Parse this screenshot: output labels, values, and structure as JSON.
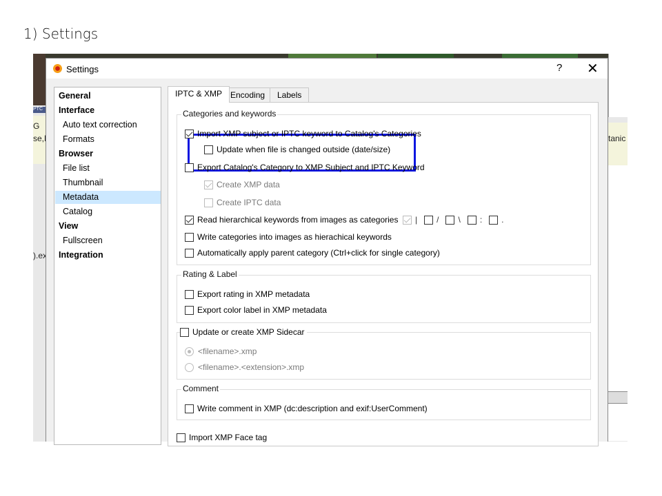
{
  "slide_title": "1) Settings",
  "background_app": {
    "left_texts": [
      "G",
      "se,E",
      ").ex",
      "PTC"
    ],
    "right_text": "tanic"
  },
  "dialog": {
    "title": "Settings",
    "help_label": "?",
    "close_label": "✕"
  },
  "tree": [
    {
      "label": "General",
      "level": 0
    },
    {
      "label": "Interface",
      "level": 0
    },
    {
      "label": "Auto text correction",
      "level": 1
    },
    {
      "label": "Formats",
      "level": 1
    },
    {
      "label": "Browser",
      "level": 0
    },
    {
      "label": "File list",
      "level": 1
    },
    {
      "label": "Thumbnail",
      "level": 1
    },
    {
      "label": "Metadata",
      "level": 1,
      "selected": true
    },
    {
      "label": "Catalog",
      "level": 1
    },
    {
      "label": "View",
      "level": 0
    },
    {
      "label": "Fullscreen",
      "level": 1
    },
    {
      "label": "Integration",
      "level": 0
    }
  ],
  "tabs": [
    "IPTC & XMP",
    "Encoding",
    "Labels"
  ],
  "groups": {
    "categories": {
      "title": "Categories and keywords",
      "import_xmp": {
        "label": "Import XMP subject or IPTC keyword to Catalog's Categories",
        "checked": true
      },
      "update_outside": {
        "label": "Update when file is changed outside (date/size)",
        "checked": false
      },
      "export_catalog": {
        "label": "Export Catalog's Category to XMP Subject and IPTC Keyword",
        "checked": false
      },
      "create_xmp": {
        "label": "Create XMP data",
        "checked": true,
        "disabled": true
      },
      "create_iptc": {
        "label": "Create IPTC data",
        "checked": false,
        "disabled": true
      },
      "read_hier": {
        "label": "Read hierarchical keywords from images as categories",
        "checked": true
      },
      "separators": [
        "|",
        "/",
        "\\",
        ":",
        "."
      ],
      "write_cat": {
        "label": "Write categories into images as hierachical keywords",
        "checked": false
      },
      "auto_parent": {
        "label": "Automatically apply parent category (Ctrl+click for single category)",
        "checked": false
      }
    },
    "rating": {
      "title": "Rating & Label",
      "export_rating": {
        "label": "Export rating in XMP metadata",
        "checked": false
      },
      "export_color": {
        "label": "Export color label in XMP metadata",
        "checked": false
      }
    },
    "sidecar": {
      "title": "Update or create XMP Sidecar",
      "checked": false,
      "opt1": "<filename>.xmp",
      "opt2": "<filename>.<extension>.xmp"
    },
    "comment": {
      "title": "Comment",
      "write_comment": {
        "label": "Write comment in XMP (dc:description and exif:UserComment)",
        "checked": false
      }
    },
    "face": {
      "label": "Import XMP Face tag",
      "checked": false
    }
  },
  "colors": {
    "highlight": "#0a16e0",
    "selection": "#cce8ff"
  }
}
